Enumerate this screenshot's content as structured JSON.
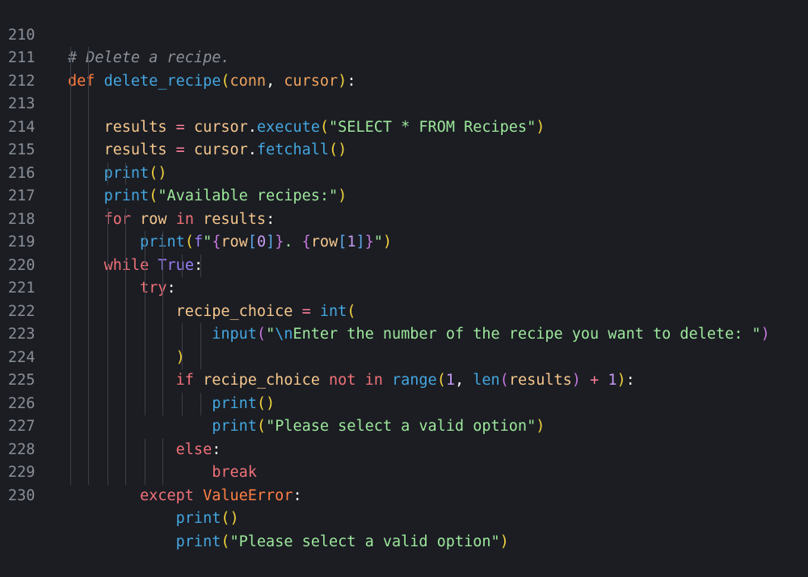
{
  "editor": {
    "lines": [
      {
        "n": "210",
        "code": "# Delete a recipe."
      },
      {
        "n": "211",
        "code": "def delete_recipe(conn, cursor):"
      },
      {
        "n": "212",
        "code": "    results = cursor.execute(\"SELECT * FROM Recipes\")"
      },
      {
        "n": "213",
        "code": "    results = cursor.fetchall()"
      },
      {
        "n": "214",
        "code": "    print()"
      },
      {
        "n": "215",
        "code": "    print(\"Available recipes:\")"
      },
      {
        "n": "216",
        "code": "    for row in results:"
      },
      {
        "n": "217",
        "code": "        print(f\"{row[0]}. {row[1]}\")"
      },
      {
        "n": "218",
        "code": "    while True:"
      },
      {
        "n": "219",
        "code": "        try:"
      },
      {
        "n": "220",
        "code": "            recipe_choice = int("
      },
      {
        "n": "221",
        "code": "                input(\"\\nEnter the number of the recipe you want to delete: \")"
      },
      {
        "n": "222",
        "code": "            )"
      },
      {
        "n": "223",
        "code": "            if recipe_choice not in range(1, len(results) + 1):"
      },
      {
        "n": "224",
        "code": "                print()"
      },
      {
        "n": "225",
        "code": "                print(\"Please select a valid option\")"
      },
      {
        "n": "226",
        "code": "            else:"
      },
      {
        "n": "227",
        "code": "                break"
      },
      {
        "n": "228",
        "code": "        except ValueError:"
      },
      {
        "n": "229",
        "code": "            print()"
      },
      {
        "n": "230",
        "code": "            print(\"Please select a valid option\")"
      }
    ]
  }
}
